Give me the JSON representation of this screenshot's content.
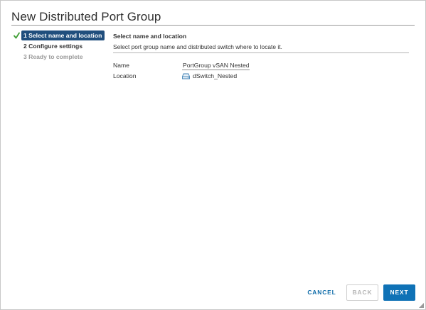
{
  "dialog": {
    "title": "New Distributed Port Group"
  },
  "steps": [
    {
      "label": "1 Select name and location",
      "state": "active",
      "completed_icon": "check-icon"
    },
    {
      "label": "2 Configure settings",
      "state": "normal"
    },
    {
      "label": "3 Ready to complete",
      "state": "disabled"
    }
  ],
  "content": {
    "section_title": "Select name and location",
    "section_desc": "Select port group name and distributed switch where to locate it.",
    "name_label": "Name",
    "name_value": "PortGroup vSAN Nested",
    "location_label": "Location",
    "location_value": "dSwitch_Nested",
    "location_icon": "distributed-switch-icon"
  },
  "footer": {
    "cancel_label": "CANCEL",
    "back_label": "BACK",
    "next_label": "NEXT"
  },
  "colors": {
    "active_step_bg": "#204e7d",
    "primary_button": "#0f72b6",
    "link_text": "#0b6aa8",
    "check_green": "#3f9e34"
  }
}
